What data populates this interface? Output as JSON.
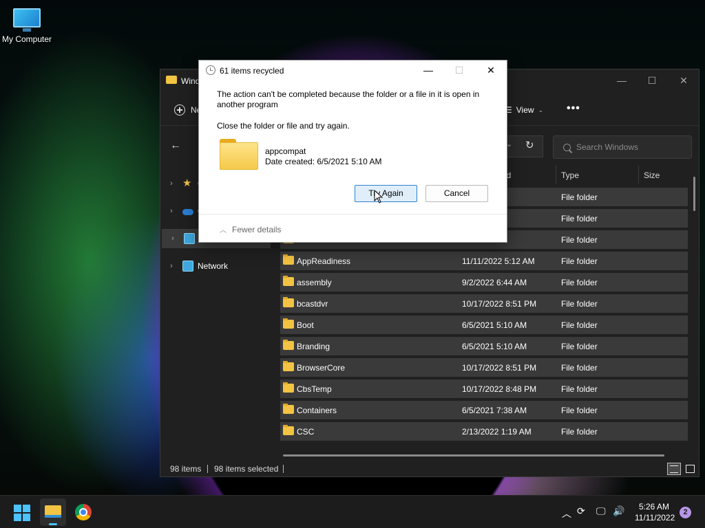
{
  "desktop": {
    "icons": [
      {
        "label": "My Computer",
        "icon": "monitor-icon"
      }
    ]
  },
  "explorer": {
    "title": "Wind",
    "toolbar": {
      "new_label": "Ne",
      "view_label": "View",
      "more_label": "•••"
    },
    "search_placeholder": "Search Windows",
    "nav": [
      {
        "label": "C",
        "icon": "star-icon"
      },
      {
        "label": "C",
        "icon": "onedrive-icon"
      },
      {
        "label": "M",
        "icon": "monitor-icon"
      },
      {
        "label": "Network",
        "icon": "network-icon"
      }
    ],
    "columns": {
      "date": "ed",
      "type": "Type",
      "size": "Size"
    },
    "rows": [
      {
        "name": "",
        "date": "0 AM",
        "type": "File folder"
      },
      {
        "name": "",
        "date": ":13 PM",
        "type": "File folder"
      },
      {
        "name": "",
        "date": ":51 PM",
        "type": "File folder"
      },
      {
        "name": "AppReadiness",
        "date": "11/11/2022 5:12 AM",
        "type": "File folder"
      },
      {
        "name": "assembly",
        "date": "9/2/2022 6:44 AM",
        "type": "File folder"
      },
      {
        "name": "bcastdvr",
        "date": "10/17/2022 8:51 PM",
        "type": "File folder"
      },
      {
        "name": "Boot",
        "date": "6/5/2021 5:10 AM",
        "type": "File folder"
      },
      {
        "name": "Branding",
        "date": "6/5/2021 5:10 AM",
        "type": "File folder"
      },
      {
        "name": "BrowserCore",
        "date": "10/17/2022 8:51 PM",
        "type": "File folder"
      },
      {
        "name": "CbsTemp",
        "date": "10/17/2022 8:48 PM",
        "type": "File folder"
      },
      {
        "name": "Containers",
        "date": "6/5/2021 7:38 AM",
        "type": "File folder"
      },
      {
        "name": "CSC",
        "date": "2/13/2022 1:19 AM",
        "type": "File folder"
      }
    ],
    "status": {
      "items": "98 items",
      "selected": "98 items selected"
    }
  },
  "dialog": {
    "title": "61 items recycled",
    "message": "The action can't be completed because the folder or a file in it is open in another program",
    "instruction": "Close the folder or file and try again.",
    "file_name": "appcompat",
    "file_date": "Date created: 6/5/2021 5:10 AM",
    "try_again_label": "Try Again",
    "cancel_label": "Cancel",
    "fewer_details_label": "Fewer details"
  },
  "taskbar": {
    "time": "5:26 AM",
    "date": "11/11/2022",
    "notification_count": "2",
    "accent": "#4cc2ff"
  }
}
